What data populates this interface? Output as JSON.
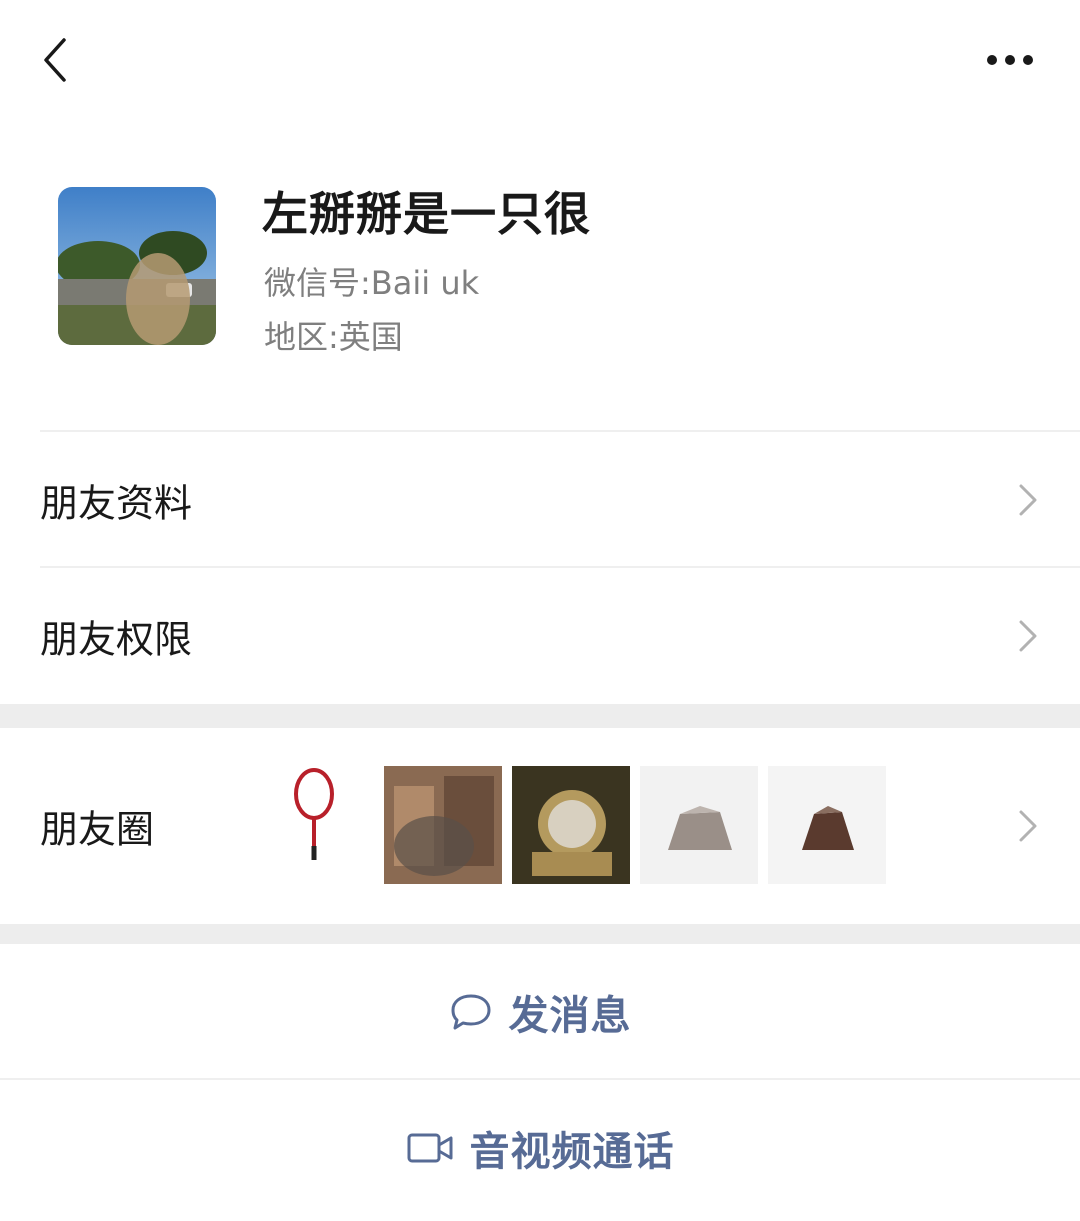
{
  "profile": {
    "name": "左掰掰是一只很",
    "wechat_id_label": "微信号",
    "wechat_id_value": "Baii uk",
    "region_label": "地区",
    "region_value": "英国",
    "separator": ":"
  },
  "menu": {
    "friend_info": "朋友资料",
    "friend_permissions": "朋友权限",
    "moments": "朋友圈"
  },
  "actions": {
    "send_message": "发消息",
    "video_call": "音视频通话"
  },
  "colors": {
    "link": "#576b95",
    "gap": "#ededed",
    "text": "#191919",
    "secondary": "#7f7f7f"
  },
  "icons": [
    "back-arrow-icon",
    "more-dots-icon",
    "chevron-right-icon",
    "chat-bubble-icon",
    "video-camera-icon"
  ]
}
